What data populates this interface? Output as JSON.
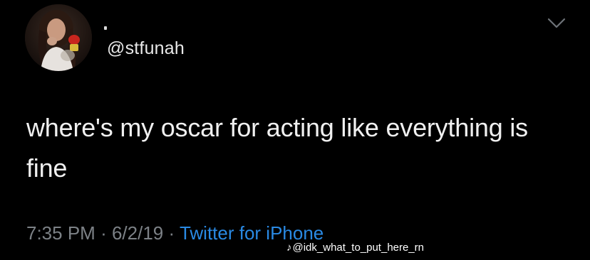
{
  "tweet": {
    "handle": "@stfunah",
    "text": "where's my oscar for acting like everything is fine",
    "time": "7:35 PM",
    "date": "6/2/19",
    "separator": "·",
    "source": "Twitter for iPhone",
    "icons": {
      "avatar": "profile-photo",
      "menu": "chevron-down-icon"
    }
  },
  "watermark": {
    "icon": "♪",
    "text": "@idk_what_to_put_here_rn"
  },
  "colors": {
    "background": "#000000",
    "text": "#f0f0f0",
    "meta": "#7c8186",
    "source_link": "#2a8ae4"
  }
}
